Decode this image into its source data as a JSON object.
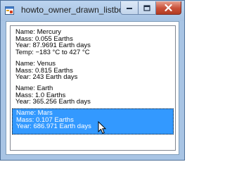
{
  "window": {
    "title": "howto_owner_drawn_listbox",
    "icons": {
      "app": "form-icon",
      "minimize": "minimize-icon",
      "maximize": "maximize-icon",
      "close": "close-icon"
    }
  },
  "listbox": {
    "selected_index": 3,
    "items": [
      {
        "lines": [
          "Name: Mercury",
          "Mass: 0.055 Earths",
          "Year: 87.9691 Earth days",
          "Temp: −183 °C to 427 °C"
        ]
      },
      {
        "lines": [
          "Name: Venus",
          "Mass: 0.815 Earths",
          "Year: 243 Earth days"
        ]
      },
      {
        "lines": [
          "Name: Earth",
          "Mass: 1.0 Earths",
          "Year: 365.256 Earth days"
        ]
      },
      {
        "lines": [
          "Name: Mars",
          "Mass: 0.107 Earths",
          "Year: 686.971 Earth days"
        ]
      }
    ]
  },
  "colors": {
    "selection": "#3399ff",
    "titlebar": "#b4cdea",
    "close_button": "#c94f38"
  }
}
